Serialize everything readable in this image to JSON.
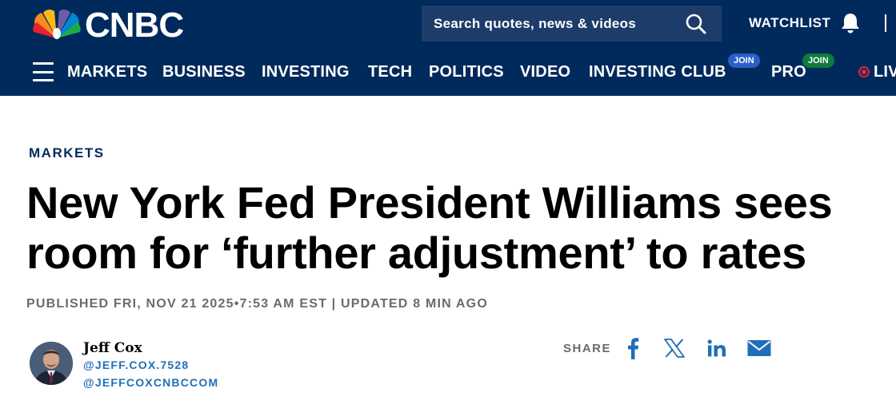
{
  "header": {
    "logo_text": "CNBC",
    "search_placeholder": "Search quotes, news & videos",
    "watchlist_label": "WATCHLIST",
    "icons": {
      "search": "search-icon",
      "bell": "bell-icon",
      "menu": "hamburger-menu-icon",
      "logo": "peacock-logo-icon"
    }
  },
  "nav": {
    "items": [
      "MARKETS",
      "BUSINESS",
      "INVESTING",
      "TECH",
      "POLITICS",
      "VIDEO",
      "INVESTING CLUB",
      "PRO",
      "LIV"
    ],
    "investing_club_badge": "JOIN",
    "pro_badge": "JOIN"
  },
  "article": {
    "section": "MARKETS",
    "headline": "New York Fed President Williams sees room for ‘further adjustment’ to rates",
    "published": "PUBLISHED FRI, NOV 21 2025•7:53 AM EST | UPDATED 8 MIN AGO",
    "author": {
      "name": "Jeff Cox",
      "handle_1": "@JEFF.COX.7528",
      "handle_2": "@JEFFCOXCNBCCOM"
    },
    "share": {
      "label": "SHARE",
      "icons": [
        "facebook-icon",
        "x-icon",
        "linkedin-icon",
        "email-icon"
      ]
    }
  },
  "colors": {
    "header_bg": "#002a5c",
    "search_bg": "#1d3c69",
    "share_blue": "#1f6fb8",
    "join_blue": "#2a5fc8",
    "join_green": "#0e7b3b",
    "live_red": "#e4243a"
  }
}
